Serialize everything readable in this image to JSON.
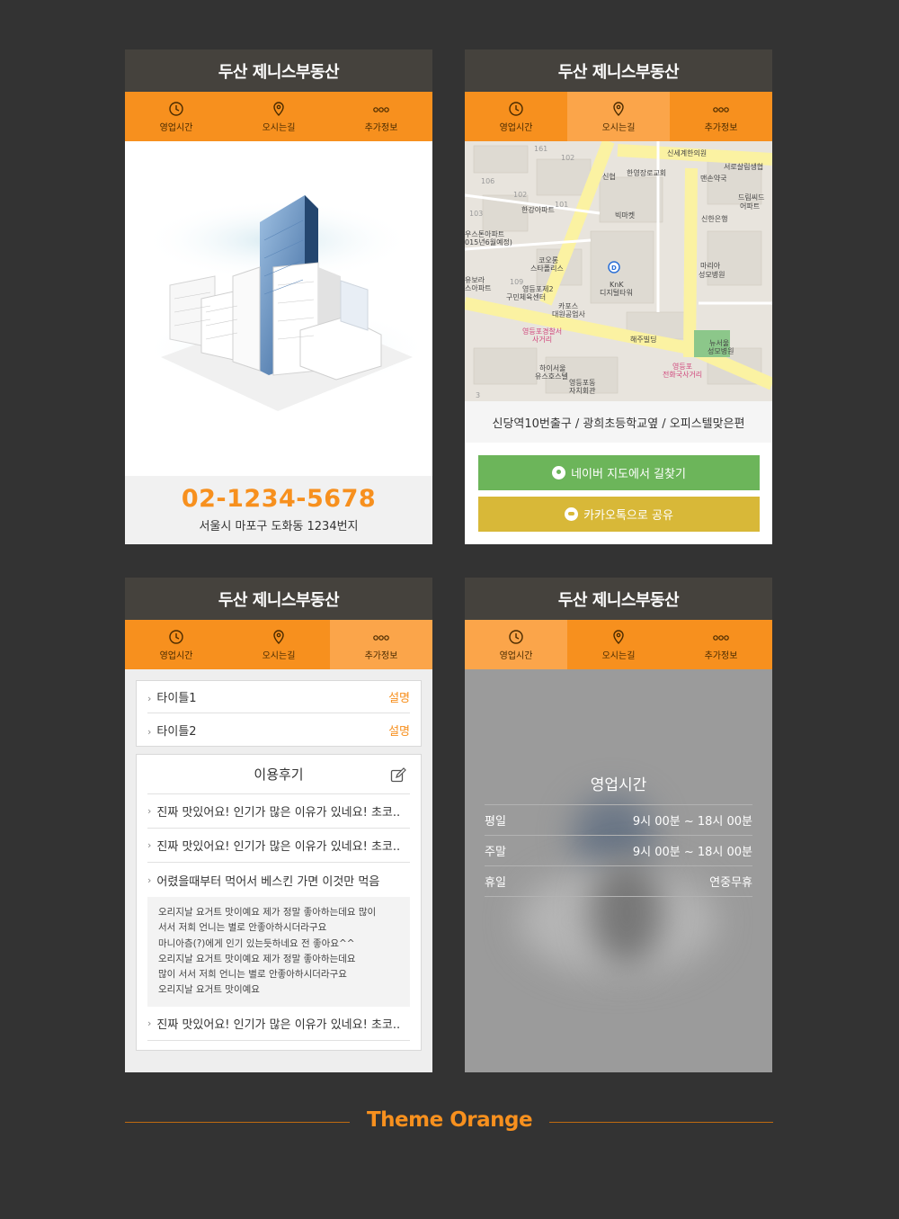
{
  "app_title": "두산 제니스부동산",
  "tabs": [
    {
      "label": "영업시간",
      "icon": "clock-icon"
    },
    {
      "label": "오시는길",
      "icon": "map-pin-icon"
    },
    {
      "label": "추가정보",
      "icon": "more-dots-icon"
    }
  ],
  "screen1": {
    "phone": "02-1234-5678",
    "address": "서울시 마포구 도화동 1234번지"
  },
  "screen2": {
    "map_labels": [
      "신세계한의원",
      "서로살림생협",
      "신협",
      "한영장로교회",
      "맨손약국",
      "드림씨드",
      "어파트",
      "한강아파트",
      "빅마켓",
      "신한은행",
      "우스톤아파트",
      "015년6월예정)",
      "코오롱",
      "스타폴리스",
      "마리아",
      "성모병원",
      "유보라",
      "스아파트",
      "영등포제2",
      "구민체육센터",
      "KnK",
      "디지털타워",
      "카포스",
      "대원공업사",
      "영등포경찰서",
      "사거리",
      "해주빌딩",
      "뉴서울",
      "성모병원",
      "하이서울",
      "유스호스텔",
      "영등포동",
      "자치회관",
      "영등포",
      "전화국사거리"
    ],
    "map_numbers": [
      "161",
      "102",
      "106",
      "102",
      "101",
      "103",
      "109",
      "3"
    ],
    "route_text": "신당역10번출구 / 광희초등학교옆 / 오피스텔맞은편",
    "naver_button": "네이버 지도에서 길찾기",
    "kakao_button": "카카오톡으로 공유"
  },
  "screen3": {
    "info": [
      {
        "title": "타이틀1",
        "desc": "설명"
      },
      {
        "title": "타이틀2",
        "desc": "설명"
      }
    ],
    "review_title": "이용후기",
    "reviews": [
      "진짜 맛있어요! 인기가 많은 이유가 있네요! 초코..",
      "진짜 맛있어요! 인기가 많은 이유가 있네요! 초코..",
      "어렸을때부터 먹어서 베스킨 가면 이것만 먹음"
    ],
    "review_body": [
      "오리지날 요거트 맛이예요 제가 정말 좋아하는데요 많이",
      "서서 저희 언니는 별로 안좋아하시더라구요",
      "마니아층(?)에게 인기 있는듯하네요 전 좋아요^^",
      "오리지날 요거트 맛이예요 제가 정말 좋아하는데요",
      "많이 서서 저희 언니는 별로 안좋아하시더라구요",
      "오리지날 요거트 맛이예요"
    ],
    "last_review": "진짜 맛있어요! 인기가 많은 이유가 있네요! 초코.."
  },
  "screen4": {
    "title": "영업시간",
    "rows": [
      {
        "day": "평일",
        "time": "9시 00분 ~ 18시 00분"
      },
      {
        "day": "주말",
        "time": "9시 00분 ~ 18시 00분"
      },
      {
        "day": "휴일",
        "time": "연중무휴"
      }
    ]
  },
  "theme_title": "Theme Orange",
  "colors": {
    "accent": "#f7901e",
    "titlebar": "#45423d",
    "naver": "#6cb55a",
    "kakao": "#d8b838",
    "background": "#333333"
  }
}
